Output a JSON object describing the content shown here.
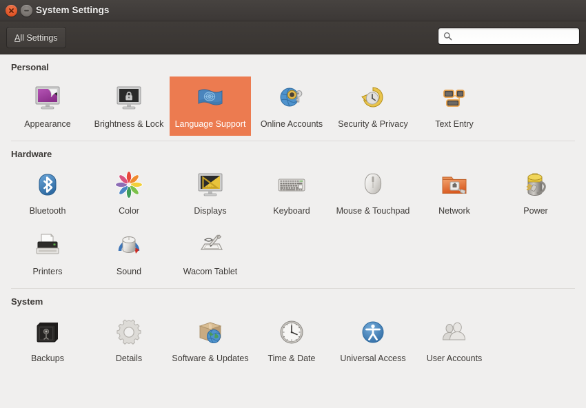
{
  "window": {
    "title": "System Settings",
    "close_icon": "close-icon",
    "minimize_icon": "minimize-icon"
  },
  "toolbar": {
    "all_settings_label": "All Settings",
    "all_settings_accel": "A",
    "all_settings_rest": "ll Settings",
    "search_placeholder": "",
    "search_value": "",
    "search_icon": "search-icon"
  },
  "colors": {
    "selection": "#ec7b50",
    "titlebar": "#3c3836",
    "content_bg": "#f0efee",
    "close_button": "#e05528",
    "divider": "#dcdad7"
  },
  "sections": [
    {
      "title": "Personal",
      "rows": [
        [
          {
            "label": "Appearance",
            "icon": "appearance-icon",
            "selected": false
          },
          {
            "label": "Brightness & Lock",
            "icon": "brightness-lock-icon",
            "selected": false
          },
          {
            "label": "Language Support",
            "icon": "language-support-icon",
            "selected": true
          },
          {
            "label": "Online Accounts",
            "icon": "online-accounts-icon",
            "selected": false
          },
          {
            "label": "Security & Privacy",
            "icon": "security-privacy-icon",
            "selected": false
          },
          {
            "label": "Text Entry",
            "icon": "text-entry-icon",
            "selected": false
          }
        ]
      ]
    },
    {
      "title": "Hardware",
      "rows": [
        [
          {
            "label": "Bluetooth",
            "icon": "bluetooth-icon",
            "selected": false
          },
          {
            "label": "Color",
            "icon": "color-icon",
            "selected": false
          },
          {
            "label": "Displays",
            "icon": "displays-icon",
            "selected": false
          },
          {
            "label": "Keyboard",
            "icon": "keyboard-icon",
            "selected": false
          },
          {
            "label": "Mouse & Touchpad",
            "icon": "mouse-touchpad-icon",
            "selected": false
          },
          {
            "label": "Network",
            "icon": "network-icon",
            "selected": false
          },
          {
            "label": "Power",
            "icon": "power-icon",
            "selected": false
          }
        ],
        [
          {
            "label": "Printers",
            "icon": "printers-icon",
            "selected": false
          },
          {
            "label": "Sound",
            "icon": "sound-icon",
            "selected": false
          },
          {
            "label": "Wacom Tablet",
            "icon": "wacom-tablet-icon",
            "selected": false
          }
        ]
      ]
    },
    {
      "title": "System",
      "rows": [
        [
          {
            "label": "Backups",
            "icon": "backups-icon",
            "selected": false
          },
          {
            "label": "Details",
            "icon": "details-icon",
            "selected": false
          },
          {
            "label": "Software & Updates",
            "icon": "software-updates-icon",
            "selected": false
          },
          {
            "label": "Time & Date",
            "icon": "time-date-icon",
            "selected": false
          },
          {
            "label": "Universal Access",
            "icon": "universal-access-icon",
            "selected": false
          },
          {
            "label": "User Accounts",
            "icon": "user-accounts-icon",
            "selected": false
          }
        ]
      ]
    }
  ]
}
